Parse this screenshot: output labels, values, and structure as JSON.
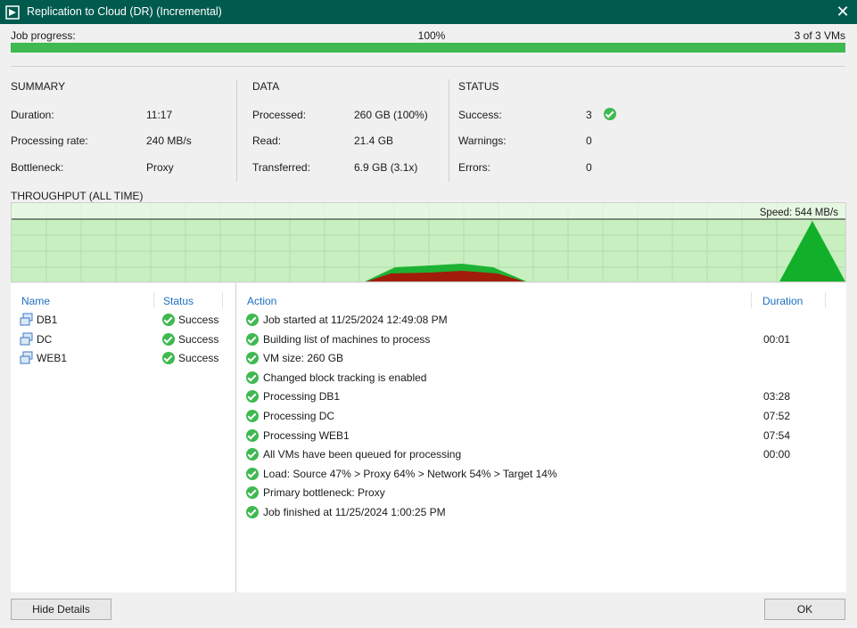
{
  "window": {
    "title": "Replication to Cloud (DR) (Incremental)",
    "close_glyph": "✕"
  },
  "progress": {
    "label": "Job progress:",
    "percent_text": "100%",
    "value": 1.0,
    "vms_text": "3 of 3 VMs",
    "color": "#3fb950"
  },
  "summary": {
    "heading": "SUMMARY",
    "items": [
      {
        "label": "Duration:",
        "value": "11:17"
      },
      {
        "label": "Processing rate:",
        "value": "240 MB/s"
      },
      {
        "label": "Bottleneck:",
        "value": "Proxy"
      }
    ]
  },
  "data_section": {
    "heading": "DATA",
    "items": [
      {
        "label": "Processed:",
        "value": "260 GB (100%)"
      },
      {
        "label": "Read:",
        "value": "21.4 GB"
      },
      {
        "label": "Transferred:",
        "value": "6.9 GB (3.1x)"
      }
    ]
  },
  "status": {
    "heading": "STATUS",
    "items": [
      {
        "label": "Success:",
        "value": "3"
      },
      {
        "label": "Warnings:",
        "value": "0"
      },
      {
        "label": "Errors:",
        "value": "0"
      }
    ],
    "success_icon": "check-circle-icon"
  },
  "throughput": {
    "heading": "THROUGHPUT (ALL TIME)",
    "speed_label": "Speed: 544 MB/s",
    "colors": {
      "background": "#c7efbf",
      "read": "#1db233",
      "transfer": "#a21c0a",
      "peak": "#12b02a"
    }
  },
  "vm_list": {
    "headers": {
      "name": "Name",
      "status": "Status"
    },
    "rows": [
      {
        "name": "DB1",
        "status": "Success"
      },
      {
        "name": "DC",
        "status": "Success"
      },
      {
        "name": "WEB1",
        "status": "Success"
      }
    ]
  },
  "actions": {
    "headers": {
      "action": "Action",
      "duration": "Duration"
    },
    "rows": [
      {
        "text": "Job started at 11/25/2024 12:49:08 PM",
        "duration": ""
      },
      {
        "text": "Building list of machines to process",
        "duration": "00:01"
      },
      {
        "text": "VM size: 260 GB",
        "duration": ""
      },
      {
        "text": "Changed block tracking is enabled",
        "duration": ""
      },
      {
        "text": "Processing DB1",
        "duration": "03:28"
      },
      {
        "text": "Processing DC",
        "duration": "07:52"
      },
      {
        "text": "Processing WEB1",
        "duration": "07:54"
      },
      {
        "text": "All VMs have been queued for processing",
        "duration": "00:00"
      },
      {
        "text": "Load: Source 47% > Proxy 64% > Network 54% > Target 14%",
        "duration": ""
      },
      {
        "text": "Primary bottleneck: Proxy",
        "duration": ""
      },
      {
        "text": "Job finished at 11/25/2024 1:00:25 PM",
        "duration": ""
      }
    ]
  },
  "buttons": {
    "hide_details": "Hide Details",
    "ok": "OK"
  }
}
